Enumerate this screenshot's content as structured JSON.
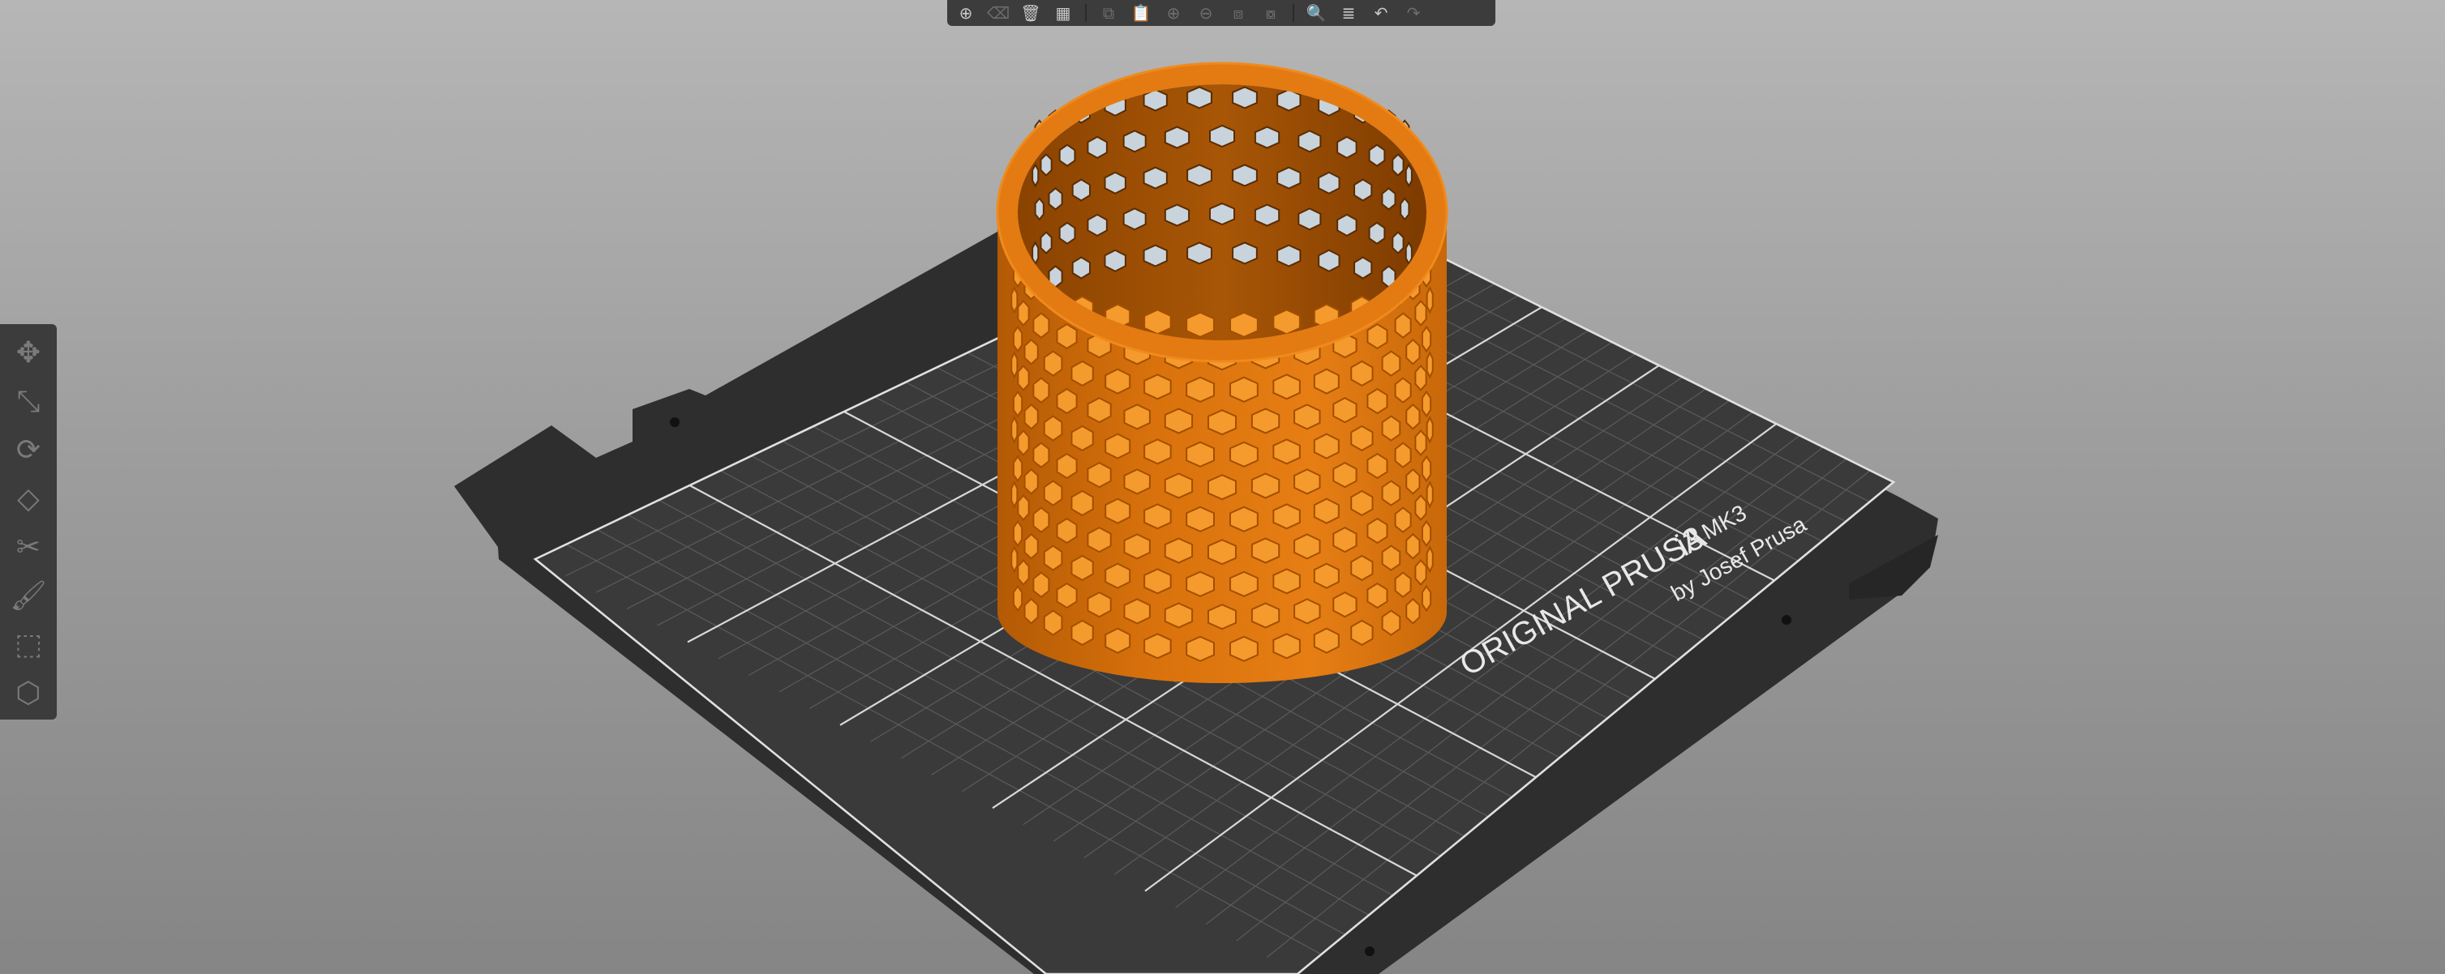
{
  "bed": {
    "label_title": "ORIGINAL PRUSA",
    "label_model": "i3",
    "label_version": "MK3",
    "label_author": "by Josef Prusa",
    "colors": {
      "plate": "#2e2e2e",
      "grid": "#595959",
      "grid_major": "#e8e8e8",
      "model": "#e07a10"
    }
  },
  "top_toolbar": {
    "items": [
      {
        "name": "add-icon",
        "glyph": "⊕",
        "enabled": true
      },
      {
        "name": "delete-icon",
        "glyph": "⌫",
        "enabled": false
      },
      {
        "name": "delete-all-icon",
        "glyph": "🗑",
        "enabled": true
      },
      {
        "name": "arrange-icon",
        "glyph": "▦",
        "enabled": true
      },
      {
        "name": "copy-icon",
        "glyph": "⧉",
        "enabled": false
      },
      {
        "name": "paste-icon",
        "glyph": "📋",
        "enabled": false
      },
      {
        "name": "add-instance-icon",
        "glyph": "⊕",
        "enabled": false
      },
      {
        "name": "remove-instance-icon",
        "glyph": "⊖",
        "enabled": false
      },
      {
        "name": "split-objects-icon",
        "glyph": "⧈",
        "enabled": false
      },
      {
        "name": "split-parts-icon",
        "glyph": "⧇",
        "enabled": false
      },
      {
        "name": "search-icon",
        "glyph": "🔍",
        "enabled": true
      },
      {
        "name": "layers-icon",
        "glyph": "≣",
        "enabled": true
      },
      {
        "name": "undo-icon",
        "glyph": "↶",
        "enabled": true
      },
      {
        "name": "redo-icon",
        "glyph": "↷",
        "enabled": false
      }
    ]
  },
  "left_toolbar": {
    "items": [
      {
        "name": "move-icon",
        "glyph": "✥"
      },
      {
        "name": "scale-icon",
        "glyph": "⤡"
      },
      {
        "name": "rotate-icon",
        "glyph": "⟳"
      },
      {
        "name": "place-on-face-icon",
        "glyph": "◇"
      },
      {
        "name": "cut-icon",
        "glyph": "✂"
      },
      {
        "name": "paint-supports-icon",
        "glyph": "🖌"
      },
      {
        "name": "seam-painting-icon",
        "glyph": "⬚"
      },
      {
        "name": "view-cube-icon",
        "glyph": "⬡"
      }
    ]
  }
}
